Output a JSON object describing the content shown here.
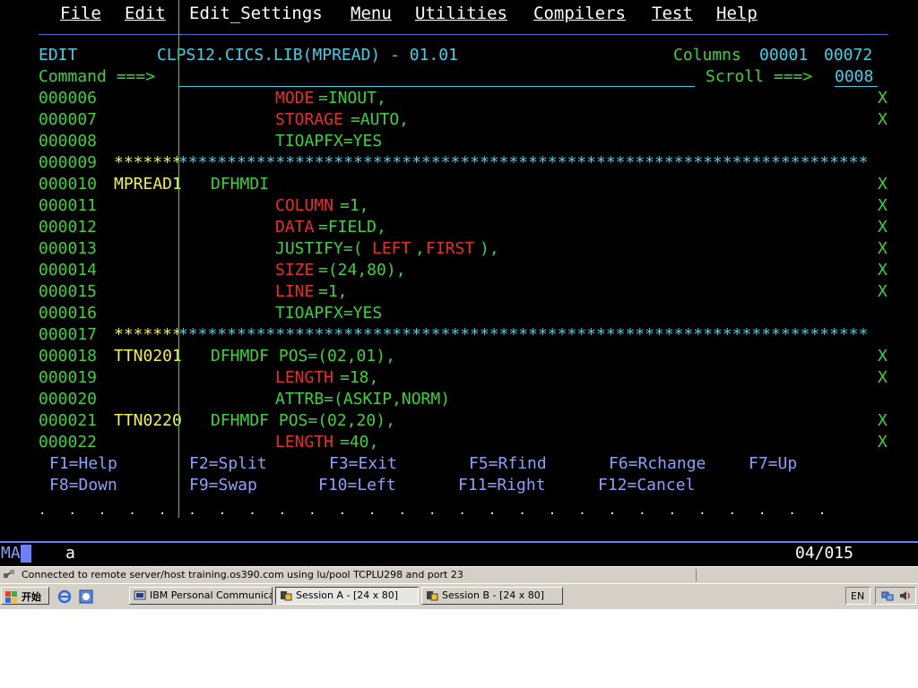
{
  "menu": {
    "file": "File",
    "edit": "Edit",
    "edit_settings": "Edit_Settings",
    "menu": "Menu",
    "utilities": "Utilities",
    "compilers": "Compilers",
    "test": "Test",
    "help": "Help"
  },
  "header": {
    "mode": "EDIT",
    "dataset": "CLPS12.CICS.LIB(MPREAD) - 01.01",
    "columns_label": "Columns",
    "col_from": "00001",
    "col_to": "00072",
    "command_label": "Command ===>",
    "command_value": "",
    "scroll_label": "Scroll ===>",
    "scroll_value": "0008"
  },
  "lines": [
    {
      "num": "000006",
      "label": "",
      "stmt": "",
      "kw": "MODE",
      "val": "=INOUT,",
      "flag": "X"
    },
    {
      "num": "000007",
      "label": "",
      "stmt": "",
      "kw": "STORAGE",
      "val": "=AUTO,",
      "flag": "X"
    },
    {
      "num": "000008",
      "label": "",
      "stmt": "",
      "kw": "",
      "val": "TIOAPFX=YES",
      "flag": ""
    },
    {
      "num": "000009",
      "stars": "************************************************************************",
      "flag": ""
    },
    {
      "num": "000010",
      "label": "MPREAD1",
      "stmt": "DFHMDI",
      "kw": "",
      "val": "",
      "flag": "X"
    },
    {
      "num": "000011",
      "label": "",
      "stmt": "",
      "kw": "COLUMN",
      "val": "=1,",
      "flag": "X"
    },
    {
      "num": "000012",
      "label": "",
      "stmt": "",
      "kw": "DATA",
      "val": "=FIELD,",
      "flag": "X"
    },
    {
      "num": "000013",
      "label": "",
      "stmt": "",
      "kw": "",
      "val": "",
      "justify": {
        "a": "JUSTIFY=(",
        "b": "LEFT",
        "c": ",",
        "d": "FIRST",
        "e": "),"
      },
      "flag": "X"
    },
    {
      "num": "000014",
      "label": "",
      "stmt": "",
      "kw": "SIZE",
      "val": "=(24,80),",
      "flag": "X"
    },
    {
      "num": "000015",
      "label": "",
      "stmt": "",
      "kw": "LINE",
      "val": "=1,",
      "flag": "X"
    },
    {
      "num": "000016",
      "label": "",
      "stmt": "",
      "kw": "",
      "val": "TIOAPFX=YES",
      "flag": ""
    },
    {
      "num": "000017",
      "stars": "************************************************************************",
      "flag": ""
    },
    {
      "num": "000018",
      "label": "TTN0201",
      "stmt": "DFHMDF POS=(02,01),",
      "kw": "",
      "val": "",
      "flag": "X"
    },
    {
      "num": "000019",
      "label": "",
      "stmt": "",
      "kw": "LENGTH",
      "val": "=18,",
      "flag": "X"
    },
    {
      "num": "000020",
      "label": "",
      "stmt": "",
      "kw": "",
      "val": "ATTRB=(ASKIP,NORM)",
      "flag": ""
    },
    {
      "num": "000021",
      "label": "TTN0220",
      "stmt": "DFHMDF POS=(02,20),",
      "kw": "",
      "val": "",
      "flag": "X"
    },
    {
      "num": "000022",
      "label": "",
      "stmt": "",
      "kw": "LENGTH",
      "val": "=40,",
      "flag": "X"
    }
  ],
  "fkeys": {
    "f1": "F1=Help",
    "f2": "F2=Split",
    "f3": "F3=Exit",
    "f5": "F5=Rfind",
    "f6": "F6=Rchange",
    "f7": "F7=Up",
    "f8": "F8=Down",
    "f9": "F9=Swap",
    "f10": "F10=Left",
    "f11": "F11=Right",
    "f12": "F12=Cancel"
  },
  "dots": ". . . . . . . . . . . . . . . . . . . . . . . . . . .",
  "oia": {
    "left": "MA",
    "mark": "a",
    "pos": "04/015"
  },
  "status": {
    "text": "Connected to remote server/host training.os390.com using lu/pool TCPLU298 and port 23"
  },
  "taskbar": {
    "start": "开始",
    "tasks": [
      "IBM Personal Communica...",
      "Session A - [24 x 80]",
      "Session B - [24 x 80]"
    ],
    "lang": "EN"
  },
  "colors": {
    "green": "#3cd23c",
    "red": "#e8302a",
    "yellow": "#f4f04a",
    "cyan": "#40d0e8",
    "blue": "#8aa0ff",
    "background": "#000000"
  }
}
